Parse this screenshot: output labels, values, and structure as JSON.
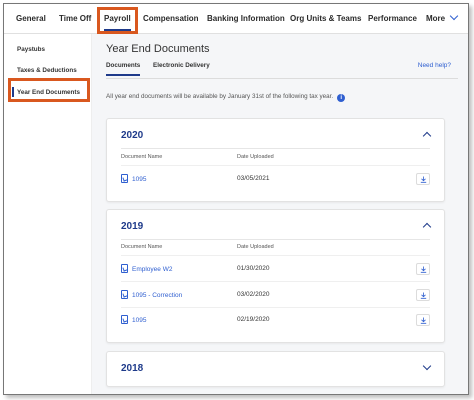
{
  "nav": {
    "items": [
      "General",
      "Time Off",
      "Payroll",
      "Compensation",
      "Banking Information",
      "Org Units & Teams",
      "Performance",
      "More"
    ],
    "active": "Payroll"
  },
  "sidebar": {
    "items": [
      "Paystubs",
      "Taxes & Deductions",
      "Year End Documents"
    ],
    "active": "Year End Documents"
  },
  "main": {
    "title": "Year End Documents",
    "tabs": [
      "Documents",
      "Electronic Delivery"
    ],
    "help_label": "Need help?",
    "notice": "All year end documents will be available by January 31st of the following tax year."
  },
  "columns": {
    "name": "Document Name",
    "date": "Date Uploaded"
  },
  "years": [
    {
      "year": "2020",
      "expanded": true,
      "docs": [
        {
          "name": "1095",
          "date": "03/05/2021"
        }
      ]
    },
    {
      "year": "2019",
      "expanded": true,
      "docs": [
        {
          "name": "Employee W2",
          "date": "01/30/2020"
        },
        {
          "name": "1095 - Correction",
          "date": "03/02/2020"
        },
        {
          "name": "1095",
          "date": "02/19/2020"
        }
      ]
    },
    {
      "year": "2018",
      "expanded": false,
      "docs": []
    }
  ],
  "colors": {
    "accent": "#1e3a8a",
    "link": "#2f5fd0",
    "highlight": "#d9581f"
  },
  "icons": {
    "info": "i",
    "pdf": "pdf-icon",
    "download": "download-icon"
  }
}
